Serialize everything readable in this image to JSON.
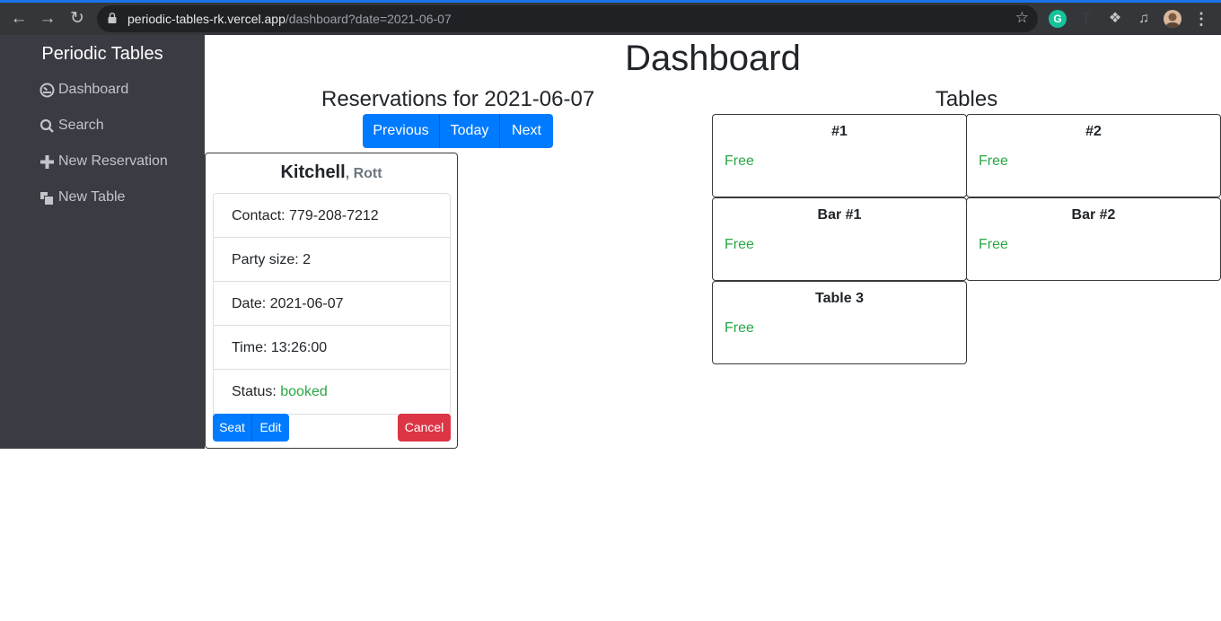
{
  "browser": {
    "url_host": "periodic-tables-rk.vercel.app",
    "url_path": "/dashboard?date=2021-06-07",
    "icons": [
      "back-icon",
      "forward-icon",
      "reload-icon",
      "lock-icon",
      "star-icon",
      "grammarly-icon",
      "text-extension-icon",
      "puzzle-icon",
      "media-icon",
      "profile-avatar",
      "kebab-menu-icon"
    ],
    "grammarly_label": "G",
    "text_ext_label": "T"
  },
  "sidebar": {
    "brand": "Periodic Tables",
    "items": [
      {
        "label": "Dashboard",
        "icon": "dashboard-icon"
      },
      {
        "label": "Search",
        "icon": "search-icon"
      },
      {
        "label": "New Reservation",
        "icon": "plus-icon"
      },
      {
        "label": "New Table",
        "icon": "layers-icon"
      }
    ]
  },
  "main": {
    "title": "Dashboard",
    "reservations_heading": "Reservations for 2021-06-07",
    "date_nav": {
      "previous": "Previous",
      "today": "Today",
      "next": "Next"
    },
    "reservations": [
      {
        "last_name": "Kitchell",
        "first_name": ", Rott",
        "contact": "Contact: 779-208-7212",
        "party_size": "Party size: 2",
        "date": "Date: 2021-06-07",
        "time": "Time: 13:26:00",
        "status_label": "Status: ",
        "status_value": "booked",
        "seat": "Seat",
        "edit": "Edit",
        "cancel": "Cancel"
      }
    ],
    "tables_heading": "Tables",
    "tables": [
      {
        "name": "#1",
        "status": "Free"
      },
      {
        "name": "#2",
        "status": "Free"
      },
      {
        "name": "Bar #1",
        "status": "Free"
      },
      {
        "name": "Bar #2",
        "status": "Free"
      },
      {
        "name": "Table 3",
        "status": "Free"
      }
    ]
  },
  "colors": {
    "sidebar_bg": "#3a3b43",
    "primary": "#007bff",
    "danger": "#dc3545",
    "success": "#28a745"
  }
}
